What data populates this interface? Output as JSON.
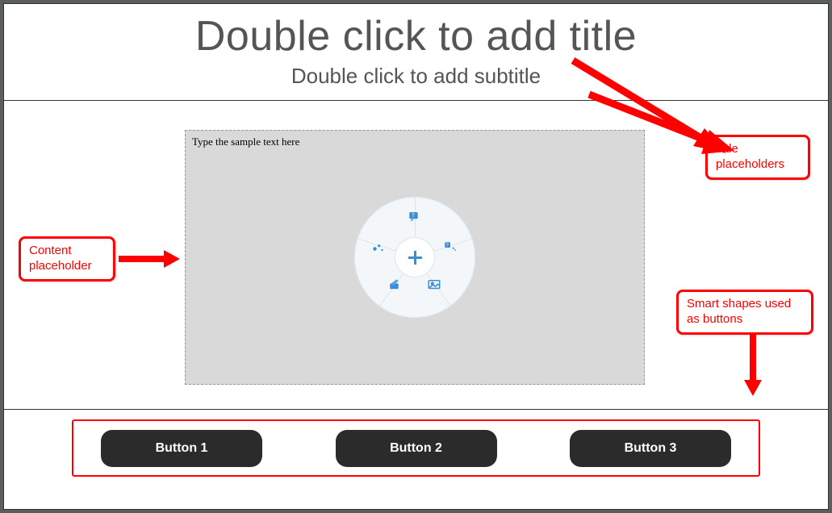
{
  "title_area": {
    "title_placeholder": "Double click to add title",
    "subtitle_placeholder": "Double click to add subtitle"
  },
  "content_placeholder": {
    "sample_text": "Type the sample text here",
    "radial_center_icon": "plus-icon",
    "radial_segments": [
      {
        "icon": "text-caption-icon"
      },
      {
        "icon": "text-animation-icon"
      },
      {
        "icon": "question-icon"
      },
      {
        "icon": "interaction-icon"
      },
      {
        "icon": "image-icon"
      }
    ]
  },
  "buttons": [
    {
      "label": "Button 1"
    },
    {
      "label": "Button 2"
    },
    {
      "label": "Button 3"
    }
  ],
  "annotations": {
    "title_callout": "Title placeholders",
    "content_callout": "Content placeholder",
    "buttons_callout": "Smart shapes used as buttons"
  }
}
